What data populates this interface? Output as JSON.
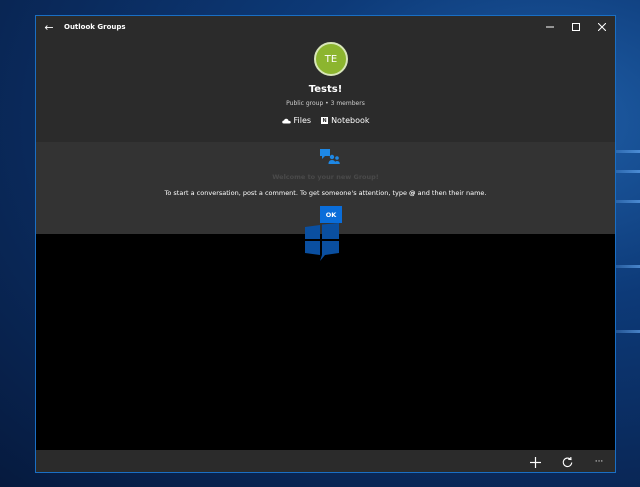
{
  "window": {
    "title": "Outlook Groups",
    "back_icon": "back-arrow-icon",
    "controls": [
      "minimize-icon",
      "maximize-icon",
      "close-icon"
    ]
  },
  "group": {
    "initials": "TE",
    "name": "Tests!",
    "meta": "Public group • 3 members",
    "avatar_color": "#8cb52f",
    "links": [
      {
        "label": "Files",
        "icon": "cloud-icon"
      },
      {
        "label": "Notebook",
        "icon": "onenote-icon"
      }
    ]
  },
  "welcome": {
    "icon": "conversation-icon",
    "title": "Welcome to your new Group!",
    "body_prefix": "To start a conversation, post a comment. To get someone's attention, type ",
    "body_at": "@",
    "body_suffix": " and then their name.",
    "ok_label": "OK",
    "accent": "#0a6dd9"
  },
  "bottombar": {
    "actions": [
      "add-icon",
      "refresh-icon",
      "more-icon"
    ],
    "more_label": "···"
  }
}
